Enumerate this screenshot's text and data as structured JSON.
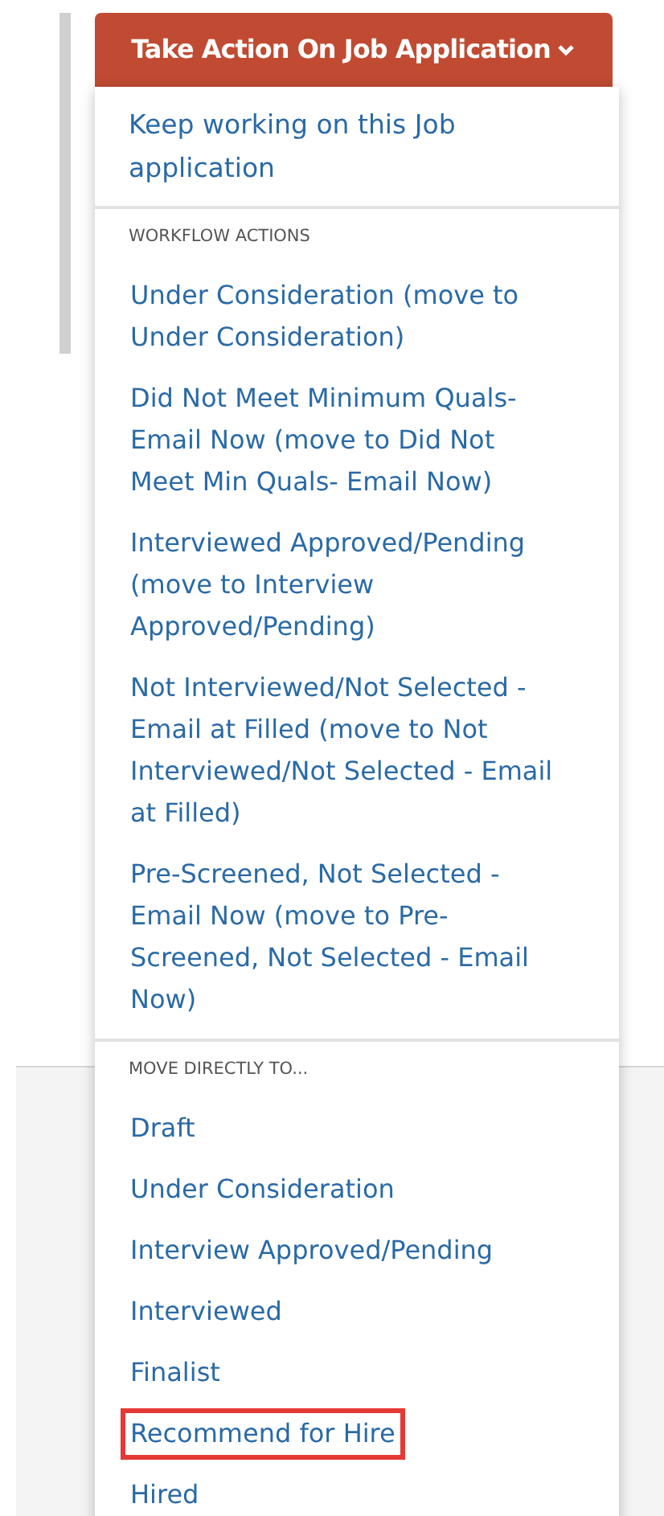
{
  "button": {
    "label": "Take Action On Job Application"
  },
  "menu": {
    "top_item": "Keep working on this Job application",
    "sections": [
      {
        "header": "WORKFLOW ACTIONS",
        "items": [
          {
            "label": "Under Consideration (move to Under Consideration)",
            "highlighted": false
          },
          {
            "label": "Did Not Meet Minimum Quals- Email Now (move to Did Not Meet Min Quals- Email Now)",
            "highlighted": false
          },
          {
            "label": "Interviewed Approved/Pending (move to Interview Approved/Pending)",
            "highlighted": false
          },
          {
            "label": "Not Interviewed/Not Selected - Email at Filled (move to Not Interviewed/Not Selected - Email at Filled)",
            "highlighted": false
          },
          {
            "label": "Pre-Screened, Not Selected - Email Now (move to Pre-Screened, Not Selected - Email Now)",
            "highlighted": false
          }
        ]
      },
      {
        "header": "MOVE DIRECTLY TO...",
        "items": [
          {
            "label": "Draft",
            "highlighted": false
          },
          {
            "label": "Under Consideration",
            "highlighted": false
          },
          {
            "label": "Interview Approved/Pending",
            "highlighted": false
          },
          {
            "label": "Interviewed",
            "highlighted": false
          },
          {
            "label": "Finalist",
            "highlighted": false
          },
          {
            "label": "Recommend for Hire",
            "highlighted": true
          },
          {
            "label": "Hired",
            "highlighted": false
          }
        ]
      }
    ]
  }
}
